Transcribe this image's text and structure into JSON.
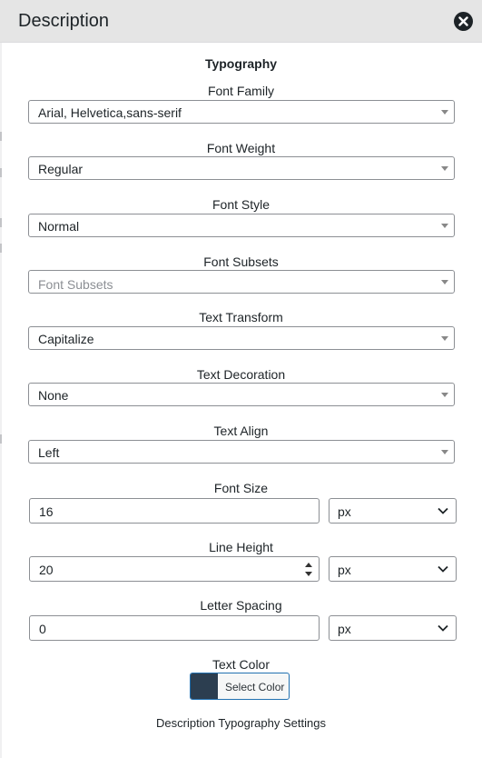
{
  "header": {
    "title": "Description"
  },
  "section_title": "Typography",
  "fields": [
    {
      "label": "Font Family",
      "value": "Arial, Helvetica,sans-serif"
    },
    {
      "label": "Font Weight",
      "value": "Regular"
    },
    {
      "label": "Font Style",
      "value": "Normal"
    },
    {
      "label": "Font Subsets",
      "placeholder": "Font Subsets"
    },
    {
      "label": "Text Transform",
      "value": "Capitalize"
    },
    {
      "label": "Text Decoration",
      "value": "None"
    },
    {
      "label": "Text Align",
      "value": "Left"
    }
  ],
  "font_size": {
    "label": "Font Size",
    "value": "16",
    "unit": "px"
  },
  "line_height": {
    "label": "Line Height",
    "value": "20",
    "unit": "px"
  },
  "letter_spacing": {
    "label": "Letter Spacing",
    "value": "0",
    "unit": "px"
  },
  "text_color": {
    "label": "Text Color",
    "button_label": "Select Color",
    "swatch_color": "#2c3e50"
  },
  "footer": "Description Typography Settings"
}
